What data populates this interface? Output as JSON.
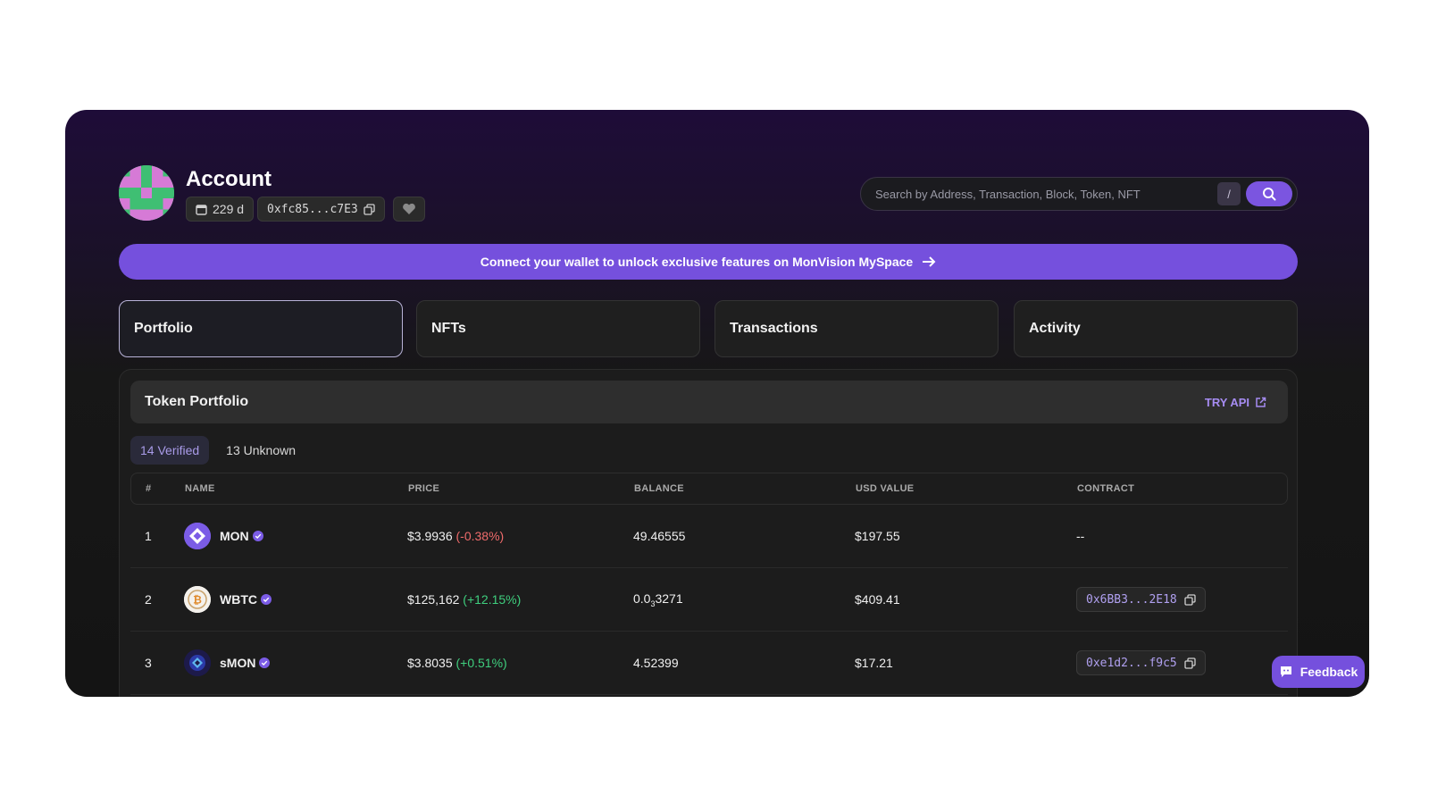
{
  "account": {
    "title": "Account",
    "age": "229 d",
    "address": "0xfc85...c7E3"
  },
  "search": {
    "placeholder": "Search by Address, Transaction, Block, Token, NFT",
    "shortcut": "/"
  },
  "banner": {
    "text": "Connect your wallet to unlock exclusive features on MonVision MySpace"
  },
  "tabs": [
    {
      "label": "Portfolio",
      "active": true
    },
    {
      "label": "NFTs",
      "active": false
    },
    {
      "label": "Transactions",
      "active": false
    },
    {
      "label": "Activity",
      "active": false
    }
  ],
  "portfolio": {
    "title": "Token Portfolio",
    "try_api": "TRY API",
    "filters": [
      {
        "label": "14 Verified",
        "active": true
      },
      {
        "label": "13 Unknown",
        "active": false
      }
    ],
    "columns": [
      "#",
      "NAME",
      "PRICE",
      "BALANCE",
      "USD VALUE",
      "CONTRACT"
    ],
    "rows": [
      {
        "num": "1",
        "name": "MON",
        "price": "$3.9936",
        "change": "(-0.38%)",
        "balance": "49.46555",
        "usd": "$197.55",
        "contract": "--"
      },
      {
        "num": "2",
        "name": "WBTC",
        "price": "$125,162",
        "change": "(+12.15%)",
        "balance_main": "0.0",
        "balance_sub": "3",
        "balance_tail": "3271",
        "usd": "$409.41",
        "contract": "0x6BB3...2E18"
      },
      {
        "num": "3",
        "name": "sMON",
        "price": "$3.8035",
        "change": "(+0.51%)",
        "balance": "4.52399",
        "usd": "$17.21",
        "contract": "0xe1d2...f9c5"
      }
    ]
  },
  "feedback": {
    "label": "Feedback"
  },
  "colors": {
    "accent": "#7550dd",
    "negative": "#ef6b6b",
    "positive": "#3fcf7e"
  }
}
